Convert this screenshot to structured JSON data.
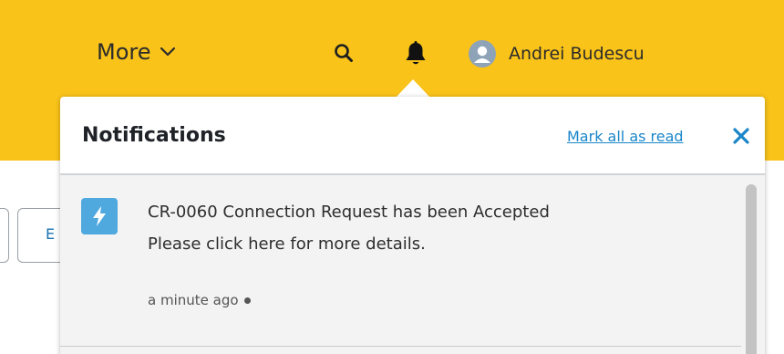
{
  "header": {
    "more_label": "More",
    "user_name": "Andrei Budescu",
    "icons": {
      "more_chevron": "chevron-down-icon",
      "search": "search-icon",
      "notifications": "bell-icon",
      "avatar": "user-avatar-icon"
    },
    "accent_color": "#f9c31a"
  },
  "page": {
    "button_fragment": "E"
  },
  "notifications": {
    "title": "Notifications",
    "mark_all_label": "Mark all as read",
    "close_icon": "close-icon",
    "items": [
      {
        "icon": "lightning-icon",
        "title": "CR-0060 Connection Request has been Accepted",
        "body": "Please click here for more details.",
        "time": "a minute ago",
        "unread": true
      }
    ]
  }
}
